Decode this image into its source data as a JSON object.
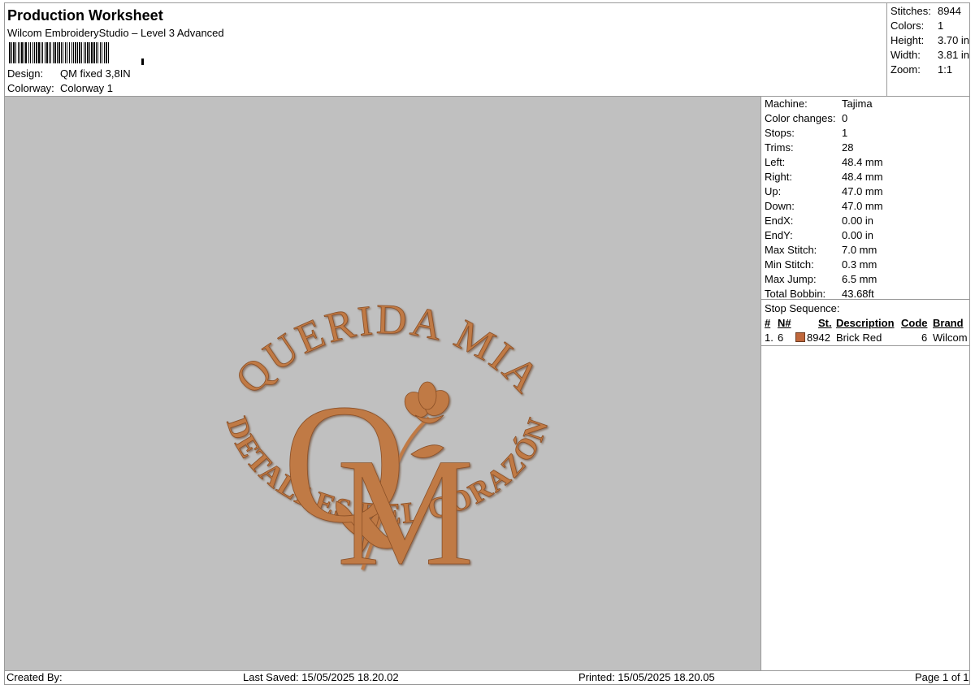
{
  "header": {
    "title": "Production Worksheet",
    "software": "Wilcom EmbroideryStudio – Level 3 Advanced",
    "design_label": "Design:",
    "design_value": "QM fixed 3,8IN",
    "colorway_label": "Colorway:",
    "colorway_value": "Colorway 1"
  },
  "stats": {
    "stitches_label": "Stitches:",
    "stitches": "8944",
    "colors_label": "Colors:",
    "colors": "1",
    "height_label": "Height:",
    "height": "3.70 in",
    "width_label": "Width:",
    "width": "3.81 in",
    "zoom_label": "Zoom:",
    "zoom": "1:1"
  },
  "machine_info": [
    {
      "label": "Machine:",
      "value": "Tajima"
    },
    {
      "label": "Color changes:",
      "value": "0"
    },
    {
      "label": "Stops:",
      "value": "1"
    },
    {
      "label": "Trims:",
      "value": "28"
    },
    {
      "label": "Left:",
      "value": "48.4 mm"
    },
    {
      "label": "Right:",
      "value": "48.4 mm"
    },
    {
      "label": "Up:",
      "value": "47.0 mm"
    },
    {
      "label": "Down:",
      "value": "47.0 mm"
    },
    {
      "label": "EndX:",
      "value": "0.00 in"
    },
    {
      "label": "EndY:",
      "value": "0.00 in"
    },
    {
      "label": "Max Stitch:",
      "value": "7.0 mm"
    },
    {
      "label": "Min Stitch:",
      "value": "0.3 mm"
    },
    {
      "label": "Max Jump:",
      "value": "6.5 mm"
    },
    {
      "label": "Total Bobbin:",
      "value": "43.68ft"
    }
  ],
  "stop_sequence": {
    "title": "Stop Sequence:",
    "headers": {
      "index": "#",
      "n": "N#",
      "st": "St.",
      "description": "Description",
      "code": "Code",
      "brand": "Brand"
    },
    "rows": [
      {
        "index": "1.",
        "n": "6",
        "st": "8942",
        "description": "Brick Red",
        "code": "6",
        "brand": "Wilcom",
        "color": "#c0673b"
      }
    ]
  },
  "design_art": {
    "top_text": "QUERIDA MIA",
    "bottom_text": "DETALLES DEL CORAZÓN",
    "monogram_1": "Q",
    "monogram_2": "M",
    "thread_color": "#c07a45",
    "background_color": "#c0c0c0"
  },
  "footer": {
    "created_by": "Created By:",
    "last_saved": "Last Saved: 15/05/2025 18.20.02",
    "printed": "Printed: 15/05/2025 18.20.05",
    "page": "Page 1 of 1"
  }
}
